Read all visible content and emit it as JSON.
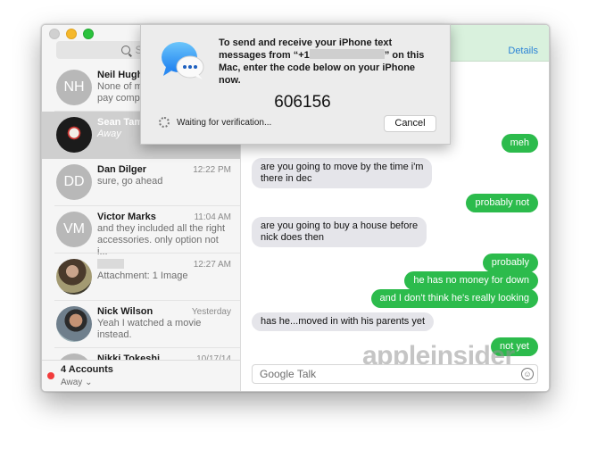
{
  "window": {
    "traffic_lights": [
      "close",
      "minimize",
      "maximize"
    ]
  },
  "sidebar": {
    "search_placeholder": "Search",
    "conversations": [
      {
        "name": "Neil Hughes",
        "initials": "NH",
        "time": "",
        "preview": "None of my\npay compa",
        "selected": false
      },
      {
        "name": "Sean Tam",
        "initials": "",
        "time": "",
        "preview": "Away",
        "selected": true
      },
      {
        "name": "Dan Dilger",
        "initials": "DD",
        "time": "12:22 PM",
        "preview": "sure, go ahead",
        "selected": false
      },
      {
        "name": "Victor Marks",
        "initials": "VM",
        "time": "11:04 AM",
        "preview": "and they included all the right accessories. only option not i...",
        "selected": false
      },
      {
        "name": "",
        "initials": "",
        "time": "12:27 AM",
        "preview": "Attachment: 1 Image",
        "selected": false
      },
      {
        "name": "Nick Wilson",
        "initials": "",
        "time": "Yesterday",
        "preview": "Yeah I watched a movie instead.",
        "selected": false
      },
      {
        "name": "Nikki Tokeshi",
        "initials": "",
        "time": "10/17/14",
        "preview": "",
        "selected": false
      }
    ],
    "footer": {
      "accounts": "4 Accounts",
      "status": "Away",
      "status_color": "#f23b3b"
    }
  },
  "chat": {
    "details_label": "Details",
    "messages": [
      {
        "dir": "out",
        "text": "meh"
      },
      {
        "dir": "in",
        "text": "are you going to move by the time i'm\nthere in dec"
      },
      {
        "dir": "out",
        "text": "probably not"
      },
      {
        "dir": "in",
        "text": "are you going to buy a house before\nnick does then"
      },
      {
        "dir": "out",
        "text": "probably"
      },
      {
        "dir": "out",
        "text": "he has no money for down"
      },
      {
        "dir": "out",
        "text": "and I don't think he's really looking"
      },
      {
        "dir": "in",
        "text": "has he...moved in with his parents yet"
      },
      {
        "dir": "out",
        "text": "not yet"
      }
    ],
    "composer_placeholder": "Google Talk",
    "watermark": "appleinsider"
  },
  "dialog": {
    "text_part1": "To send and receive your iPhone text messages from “+1",
    "text_part2": "” on this Mac, enter the code below on your iPhone now.",
    "code": "606156",
    "status": "Waiting for verification...",
    "cancel_label": "Cancel"
  },
  "colors": {
    "accent_green": "#2cbb4c",
    "link_blue": "#2b83d6",
    "incoming_bubble": "#e5e5ea"
  }
}
